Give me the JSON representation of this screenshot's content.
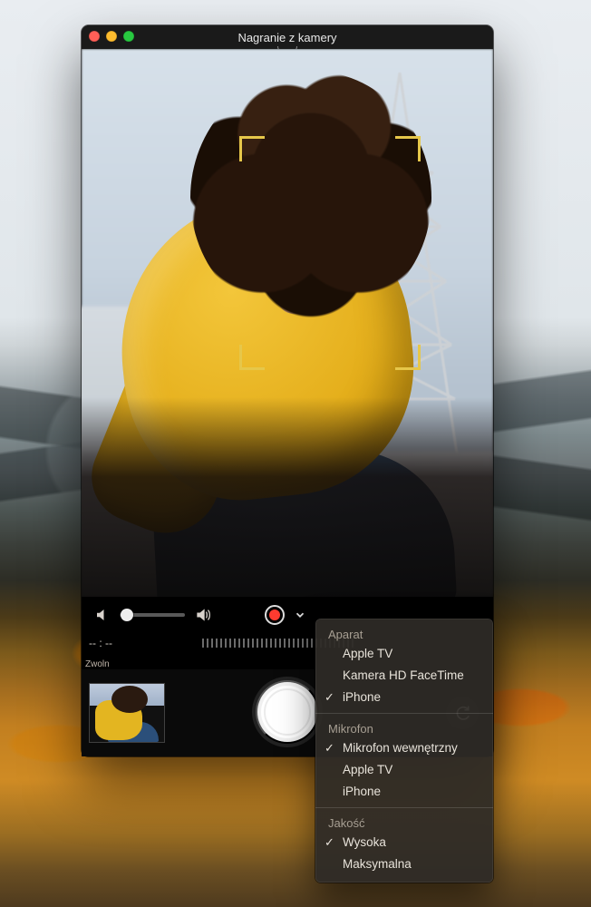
{
  "window": {
    "title": "Nagranie z kamery"
  },
  "controls": {
    "time": "-- : --",
    "zwol_label": "Zwoln"
  },
  "menu": {
    "sections": [
      {
        "label": "Aparat",
        "items": [
          {
            "label": "Apple TV",
            "checked": false
          },
          {
            "label": "Kamera HD FaceTime",
            "checked": false
          },
          {
            "label": "iPhone",
            "checked": true
          }
        ]
      },
      {
        "label": "Mikrofon",
        "items": [
          {
            "label": "Mikrofon wewnętrzny",
            "checked": true
          },
          {
            "label": "Apple TV",
            "checked": false
          },
          {
            "label": "iPhone",
            "checked": false
          }
        ]
      },
      {
        "label": "Jakość",
        "items": [
          {
            "label": "Wysoka",
            "checked": true
          },
          {
            "label": "Maksymalna",
            "checked": false
          }
        ]
      }
    ]
  }
}
